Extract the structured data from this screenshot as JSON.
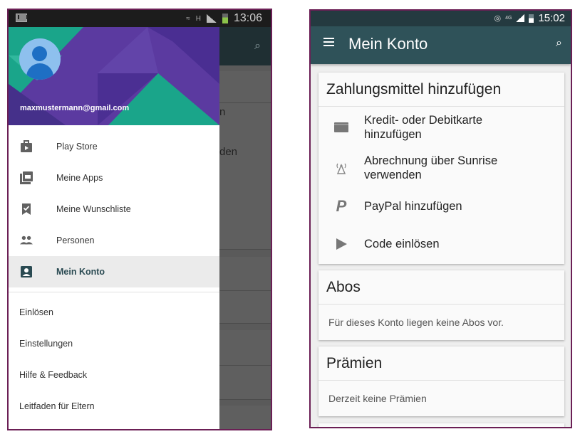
{
  "left_phone": {
    "status_bar": {
      "time": "13:06",
      "network_label": "H",
      "notification_icon": "gmail-icon"
    },
    "background": {
      "text_fragments": [
        "n",
        "den"
      ]
    },
    "drawer": {
      "email": "maxmustermann@gmail.com",
      "primary_items": [
        {
          "label": "Play Store",
          "icon": "play-store-icon",
          "active": false
        },
        {
          "label": "Meine Apps",
          "icon": "apps-icon",
          "active": false
        },
        {
          "label": "Meine Wunschliste",
          "icon": "wishlist-icon",
          "active": false
        },
        {
          "label": "Personen",
          "icon": "people-icon",
          "active": false
        },
        {
          "label": "Mein Konto",
          "icon": "account-icon",
          "active": true
        }
      ],
      "secondary_items": [
        {
          "label": "Einlösen"
        },
        {
          "label": "Einstellungen"
        },
        {
          "label": "Hilfe & Feedback"
        },
        {
          "label": "Leitfaden für Eltern"
        }
      ]
    }
  },
  "right_phone": {
    "status_bar": {
      "time": "15:02",
      "network_label": "4G"
    },
    "app_bar": {
      "title": "Mein Konto"
    },
    "payment_card": {
      "title": "Zahlungsmittel hinzufügen",
      "items": [
        {
          "label": "Kredit- oder Debitkarte hinzufügen",
          "icon": "credit-card-icon"
        },
        {
          "label": "Abrechnung über Sunrise verwenden",
          "icon": "carrier-billing-icon"
        },
        {
          "label": "PayPal hinzufügen",
          "icon": "paypal-icon"
        },
        {
          "label": "Code einlösen",
          "icon": "play-icon"
        }
      ]
    },
    "subscriptions_card": {
      "title": "Abos",
      "text": "Für dieses Konto liegen keine Abos vor."
    },
    "rewards_card": {
      "title": "Prämien",
      "text": "Derzeit keine Prämien"
    }
  },
  "colors": {
    "frame": "#6b1f55",
    "left_appbar": "#1f2f33",
    "right_appbar": "#2f5259",
    "drawer_header": "#5b3aa0",
    "drawer_accent_teal": "#1aa58a",
    "avatar_bg": "#8ec0ee",
    "avatar_fg": "#1e6fc4"
  }
}
